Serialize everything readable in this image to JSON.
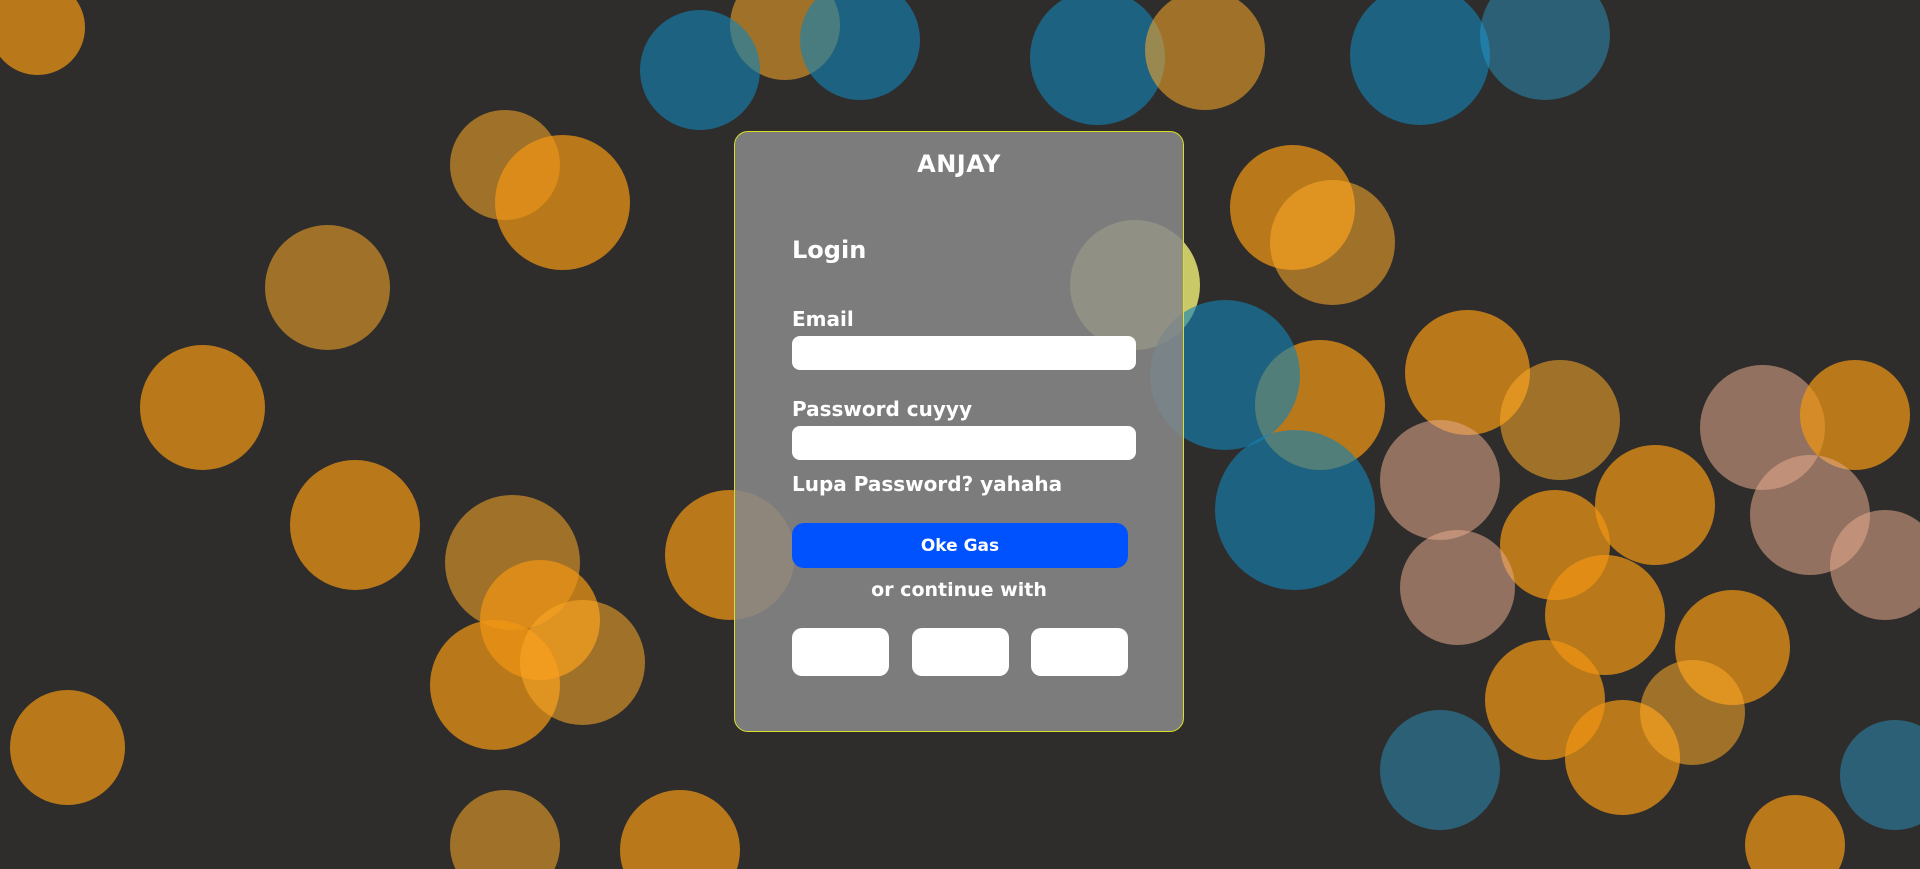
{
  "app": {
    "title": "ANJAY"
  },
  "login_form": {
    "heading": "Login",
    "email_label": "Email",
    "email_value": "",
    "password_label": "Password cuyyy",
    "password_value": "",
    "forgot_password": "Lupa Password? yahaha",
    "submit_label": "Oke Gas",
    "alternate_text": "or continue with",
    "social_buttons": [
      {
        "icon": "social-login-1",
        "label": ""
      },
      {
        "icon": "social-login-2",
        "label": ""
      },
      {
        "icon": "social-login-3",
        "label": ""
      }
    ]
  },
  "colors": {
    "primary_button": "#0052ff",
    "card_border": "#d9df27",
    "card_background": "rgba(135,135,135,0.88)",
    "text": "#ffffff"
  }
}
